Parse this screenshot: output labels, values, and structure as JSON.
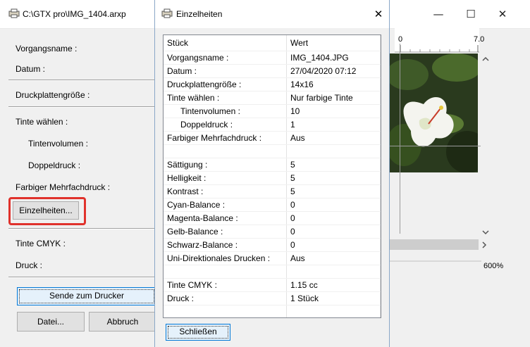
{
  "main_window": {
    "title": "C:\\GTX pro\\IMG_1404.arxp",
    "minimize_glyph": "—",
    "maximize_glyph": "☐",
    "close_glyph": "✕"
  },
  "left_panel": {
    "job_name_label": "Vorgangsname :",
    "date_label": "Datum :",
    "platen_size_label": "Druckplattengröße :",
    "ink_select_label": "Tinte wählen :",
    "ink_volume_label": "Tintenvolumen :",
    "double_print_label": "Doppeldruck :",
    "color_multipass_label": "Farbiger Mehrfachdruck :",
    "details_button": "Einzelheiten...",
    "ink_cmyk_label": "Tinte CMYK :",
    "print_label": "Druck :",
    "send_button": "Sende zum Drucker",
    "file_button": "Datei...",
    "cancel_button": "Abbruch"
  },
  "preview": {
    "ruler_start": "0",
    "ruler_end": "7.0",
    "zoom": "600%"
  },
  "dialog": {
    "title": "Einzelheiten",
    "close_glyph": "✕",
    "col_item": "Stück",
    "col_value": "Wert",
    "rows": [
      {
        "label": "Vorgangsname :",
        "value": "IMG_1404.JPG"
      },
      {
        "label": "Datum :",
        "value": "27/04/2020 07:12"
      },
      {
        "label": "Druckplattengröße :",
        "value": "14x16"
      },
      {
        "label": "Tinte wählen :",
        "value": "Nur farbige Tinte"
      },
      {
        "label": "Tintenvolumen :",
        "value": "10"
      },
      {
        "label": "Doppeldruck :",
        "value": "1"
      },
      {
        "label": "Farbiger Mehrfachdruck :",
        "value": "Aus"
      },
      {
        "label": "",
        "value": ""
      },
      {
        "label": "Sättigung :",
        "value": "5"
      },
      {
        "label": "Helligkeit :",
        "value": "5"
      },
      {
        "label": "Kontrast :",
        "value": "5"
      },
      {
        "label": "Cyan-Balance :",
        "value": "0"
      },
      {
        "label": "Magenta-Balance :",
        "value": "0"
      },
      {
        "label": "Gelb-Balance :",
        "value": "0"
      },
      {
        "label": "Schwarz-Balance :",
        "value": "0"
      },
      {
        "label": "Uni-Direktionales Drucken :",
        "value": "Aus"
      },
      {
        "label": "",
        "value": ""
      },
      {
        "label": "Tinte CMYK :",
        "value": "1.15 cc"
      },
      {
        "label": "Druck :",
        "value": "1 Stück"
      },
      {
        "label": "",
        "value": ""
      },
      {
        "label": "",
        "value": ""
      }
    ],
    "close_button": "Schließen"
  },
  "colors": {
    "highlight": "#e0322c",
    "default_button_border": "#0078d7"
  }
}
